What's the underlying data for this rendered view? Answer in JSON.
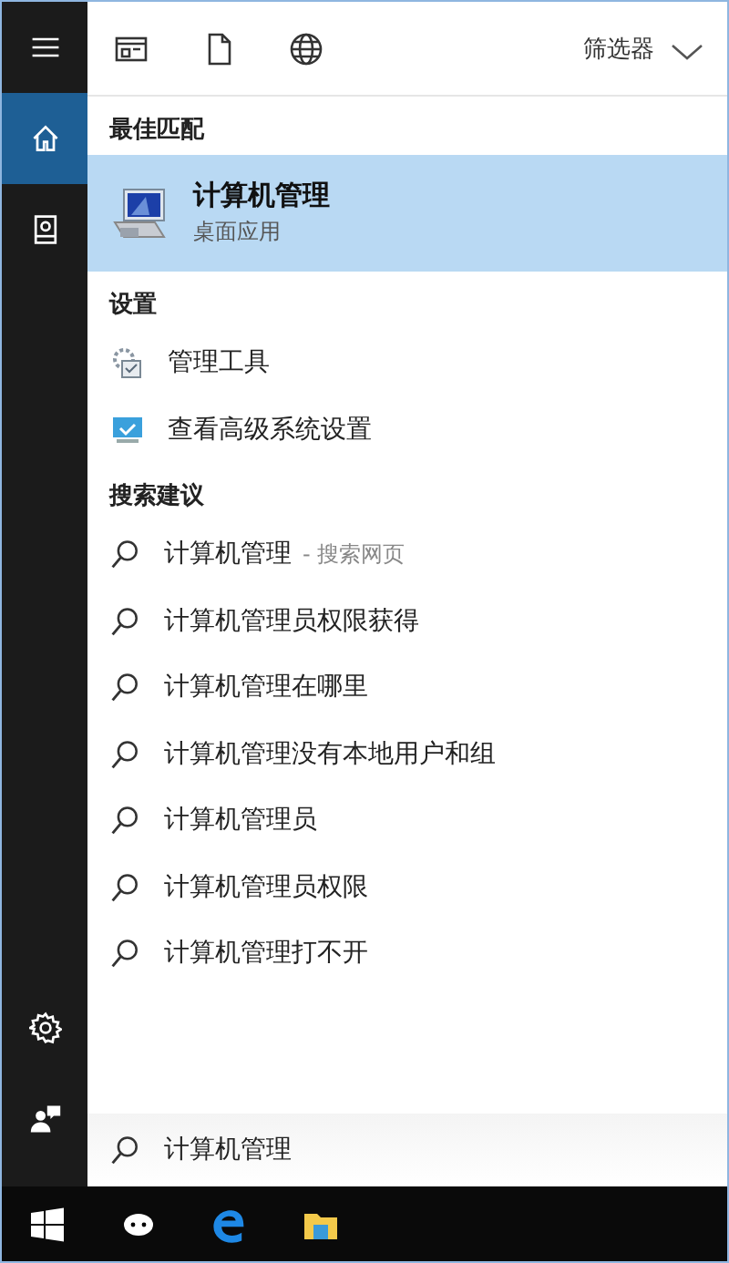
{
  "rail": {
    "items": [
      {
        "kind": "menu",
        "selected": false
      },
      {
        "kind": "home",
        "selected": true
      },
      {
        "kind": "notebook",
        "selected": false
      }
    ],
    "bottom": [
      {
        "kind": "settings"
      },
      {
        "kind": "feedback"
      }
    ]
  },
  "toolbar": {
    "icons": [
      {
        "kind": "app"
      },
      {
        "kind": "document"
      },
      {
        "kind": "web"
      }
    ],
    "filter": "筛选器"
  },
  "best_match": {
    "heading": "最佳匹配",
    "title": "计算机管理",
    "subtitle": "桌面应用",
    "selected": true
  },
  "settings": {
    "heading": "设置",
    "items": [
      {
        "kind": "tools",
        "label": "管理工具"
      },
      {
        "kind": "monitor",
        "label": "查看高级系统设置"
      }
    ]
  },
  "suggestions": {
    "heading": "搜索建议",
    "items": [
      {
        "text": "计算机管理",
        "suffix": "- 搜索网页"
      },
      {
        "text": "计算机管理员权限获得"
      },
      {
        "text": "计算机管理在哪里"
      },
      {
        "text": "计算机管理没有本地用户和组"
      },
      {
        "text": "计算机管理员"
      },
      {
        "text": "计算机管理员权限"
      },
      {
        "text": "计算机管理打不开"
      }
    ]
  },
  "search": {
    "value": "计算机管理"
  },
  "taskbar": {
    "items": [
      {
        "kind": "start"
      },
      {
        "kind": "cortana"
      },
      {
        "kind": "edge"
      },
      {
        "kind": "explorer"
      }
    ]
  }
}
